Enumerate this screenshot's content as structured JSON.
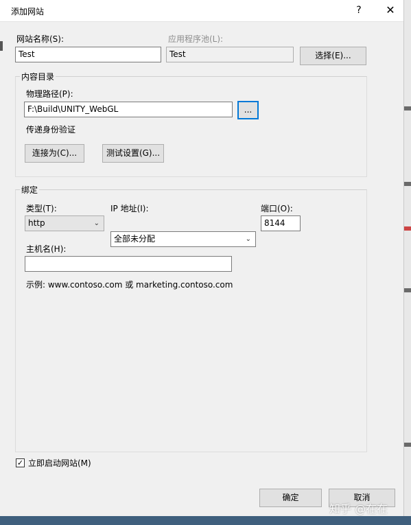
{
  "dialog": {
    "title": "添加网站",
    "help": "?",
    "close": "✕"
  },
  "site": {
    "name_label": "网站名称(S):",
    "name_value": "Test",
    "pool_label": "应用程序池(L):",
    "pool_value": "Test",
    "select_button": "选择(E)..."
  },
  "content": {
    "group_title": "内容目录",
    "path_label": "物理路径(P):",
    "path_value": "F:\\Build\\UNITY_WebGL",
    "browse_button": "...",
    "auth_label": "传递身份验证",
    "connect_as_button": "连接为(C)...",
    "test_settings_button": "测试设置(G)..."
  },
  "binding": {
    "group_title": "绑定",
    "type_label": "类型(T):",
    "type_value": "http",
    "ip_label": "IP 地址(I):",
    "ip_value": "全部未分配",
    "port_label": "端口(O):",
    "port_value": "8144",
    "hostname_label": "主机名(H):",
    "hostname_value": "",
    "example": "示例: www.contoso.com 或 marketing.contoso.com"
  },
  "start_now": {
    "label": "立即启动网站(M)",
    "checked": "✓"
  },
  "footer": {
    "ok_button": "确定",
    "cancel_button": "取消"
  },
  "watermark": "知乎 @在在"
}
